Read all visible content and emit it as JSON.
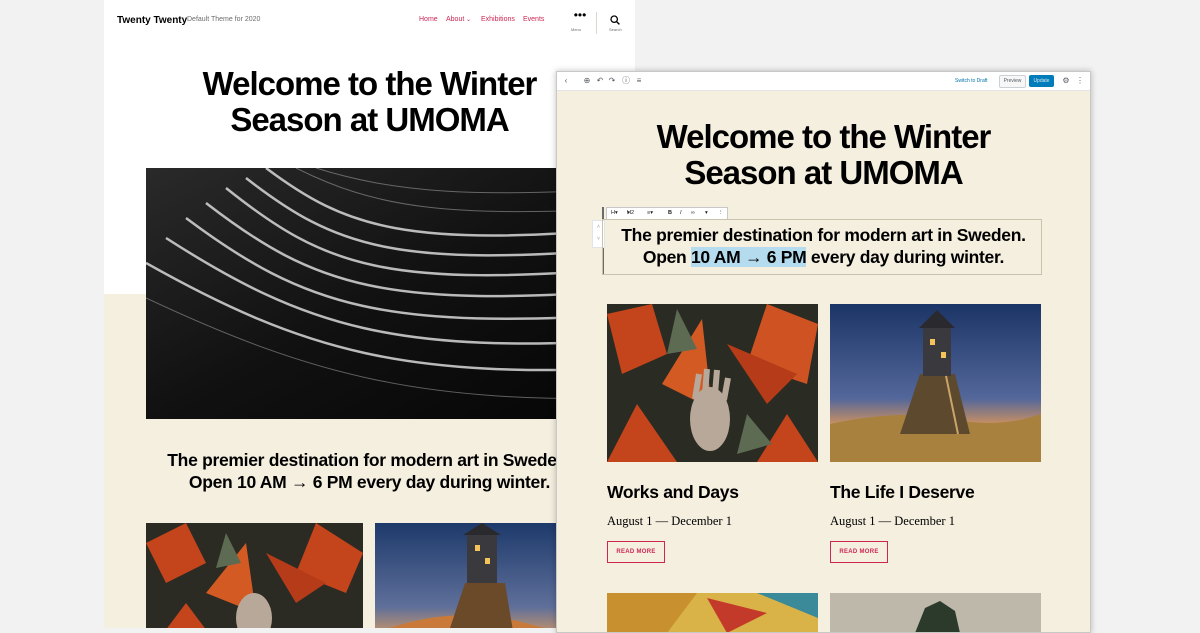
{
  "frontend": {
    "site_title": "Twenty Twenty",
    "site_description": "Default Theme for 2020",
    "nav": [
      "Home",
      "About",
      "Exhibitions",
      "Events"
    ],
    "menu_label": "Menu",
    "search_label": "Search",
    "heading_line1": "Welcome to the Winter",
    "heading_line2": "Season at UMOMA",
    "sub_line1": "The premier destination for modern art in Sweden.",
    "sub_line2": "Open 10 AM → 6 PM every day during winter."
  },
  "editor": {
    "switch_to_draft": "Switch to Draft",
    "preview": "Preview",
    "update": "Update",
    "heading_line1": "Welcome to the Winter",
    "heading_line2": "Season at UMOMA",
    "sub_line1": "The premier destination for modern art in Sweden.",
    "sub_line2_pre": "Open ",
    "sub_line2_highlight": "10 AM → 6 PM",
    "sub_line2_post": " every day during winter.",
    "block_toolbar": {
      "heading_level": "H2"
    },
    "cards": [
      {
        "title": "Works and Days",
        "date": "August 1 — December 1",
        "button": "READ MORE"
      },
      {
        "title": "The Life I Deserve",
        "date": "August 1 — December 1",
        "button": "READ MORE"
      }
    ]
  },
  "colors": {
    "accent": "#cd2653",
    "beige": "#f5efe0",
    "wp_blue": "#007cba",
    "highlight": "#b5dcee"
  }
}
